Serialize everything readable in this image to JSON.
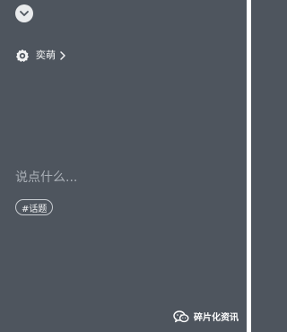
{
  "header": {
    "collapse_icon": "chevron-down-icon"
  },
  "location": {
    "icon": "location-badge-icon",
    "label": "奕萌",
    "chevron_icon": "chevron-right-icon"
  },
  "composer": {
    "value": "",
    "placeholder": "说点什么..."
  },
  "topic": {
    "label": "#话题"
  },
  "watermark": {
    "icon": "wechat-icon",
    "text": "碎片化资讯"
  },
  "colors": {
    "background": "#4e555e",
    "text": "#f2f3f4",
    "placeholder": "#aab0b7",
    "chip_border": "#c8ccd1"
  }
}
